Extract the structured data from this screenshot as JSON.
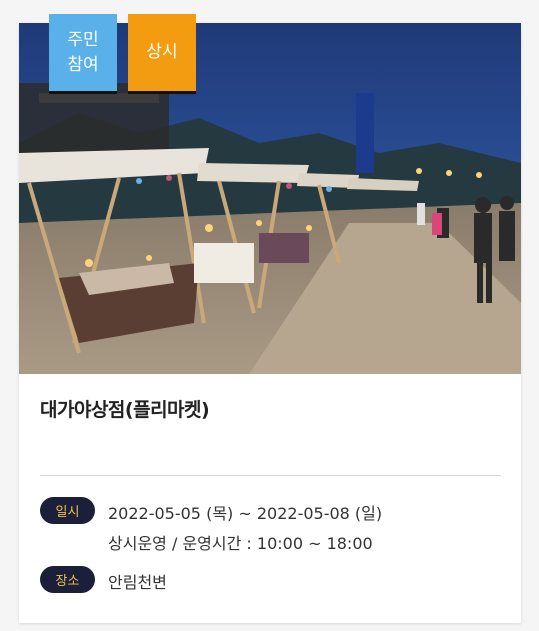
{
  "card": {
    "tags": {
      "resident_line1": "주민",
      "resident_line2": "참여",
      "always": "상시"
    },
    "title": "대가야상점(플리마켓)",
    "date_label": "일시",
    "date_value": "2022-05-05 (목) ~ 2022-05-08 (일)",
    "hours_value": "상시운영 / 운영시간 : 10:00 ~ 18:00",
    "place_label": "장소",
    "place_value": "안림천변"
  },
  "colors": {
    "tag_resident": "#5ab1ea",
    "tag_always": "#f39c12",
    "pill_bg": "#1c1f3a",
    "pill_text": "#f0c04a"
  },
  "image": {
    "subject": "night flea market stalls with tents along a riverside path"
  }
}
